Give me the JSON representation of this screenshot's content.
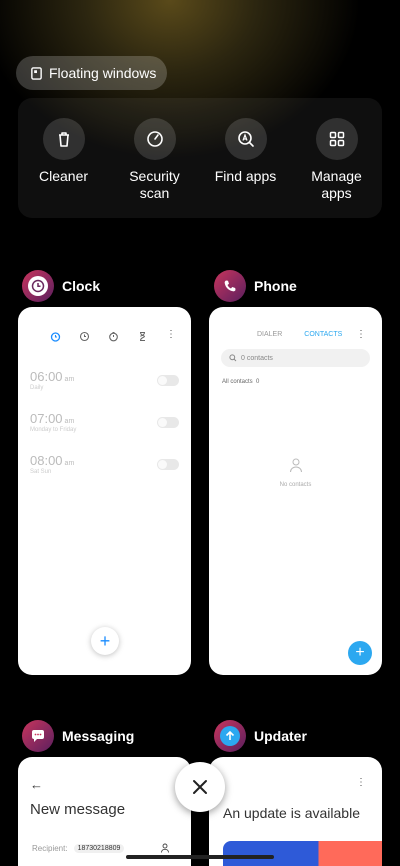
{
  "floating_windows": {
    "label": "Floating windows",
    "icon": "floating-window-icon"
  },
  "tools": [
    {
      "label": "Cleaner",
      "icon": "trash-icon"
    },
    {
      "label": "Security scan",
      "icon": "speedometer-icon"
    },
    {
      "label": "Find apps",
      "icon": "search-app-icon"
    },
    {
      "label": "Manage apps",
      "icon": "grid-icon"
    }
  ],
  "apps": {
    "clock": {
      "name": "Clock",
      "icon": "clock-icon",
      "alarms": [
        {
          "time": "06:00",
          "ampm": "am",
          "repeat": "Daily"
        },
        {
          "time": "07:00",
          "ampm": "am",
          "repeat": "Monday to Friday"
        },
        {
          "time": "08:00",
          "ampm": "am",
          "repeat": "Sat Sun"
        }
      ]
    },
    "phone": {
      "name": "Phone",
      "icon": "phone-icon",
      "tabs": [
        "DIALER",
        "CONTACTS"
      ],
      "active_tab": "CONTACTS",
      "search_placeholder": "0 contacts",
      "all_contacts": "All contacts",
      "all_contacts_count": "0",
      "empty_label": "No contacts"
    },
    "messaging": {
      "name": "Messaging",
      "icon": "message-icon",
      "back": "←",
      "title": "New message",
      "recipient_label": "Recipient:",
      "recipient_value": "18730218809"
    },
    "updater": {
      "name": "Updater",
      "icon": "arrow-up-icon",
      "title": "An update is available"
    }
  },
  "colors": {
    "accent": "#1a8cff",
    "fab_blue": "#2ca8f0",
    "app_icon": "#c8355d"
  }
}
